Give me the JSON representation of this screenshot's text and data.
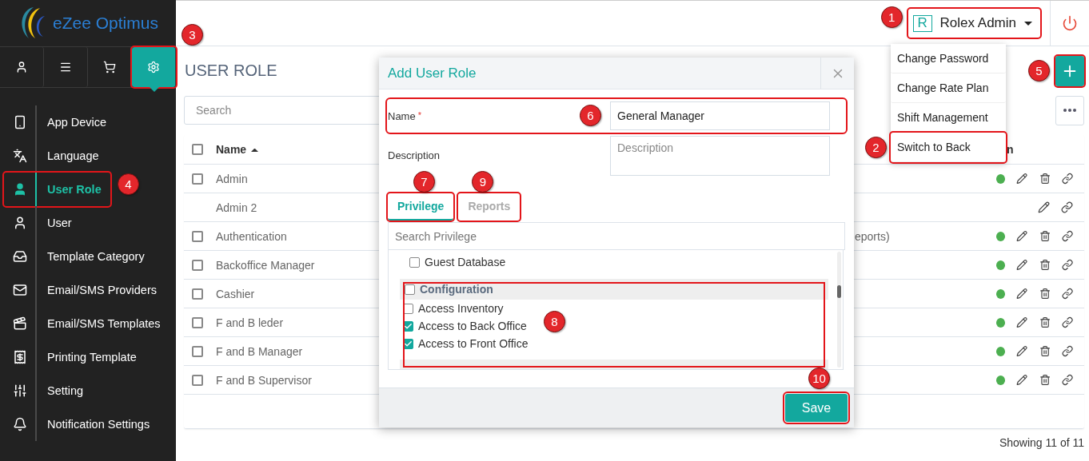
{
  "app": {
    "logo_text": "eZee Optimus"
  },
  "sidebar": {
    "tabs": [
      {
        "selected": false
      },
      {
        "selected": false
      },
      {
        "selected": false
      },
      {
        "selected": true,
        "callout": "3"
      }
    ],
    "items": [
      {
        "label": "App Device",
        "selected": false
      },
      {
        "label": "Language",
        "selected": false
      },
      {
        "label": "User Role",
        "selected": true,
        "callout": "4"
      },
      {
        "label": "User",
        "selected": false
      },
      {
        "label": "Template Category",
        "selected": false
      },
      {
        "label": "Email/SMS Providers",
        "selected": false
      },
      {
        "label": "Email/SMS Templates",
        "selected": false
      },
      {
        "label": "Printing Template",
        "selected": false
      },
      {
        "label": "Setting",
        "selected": false
      },
      {
        "label": "Notification Settings",
        "selected": false
      }
    ]
  },
  "header": {
    "user": {
      "initial": "R",
      "name": "Rolex Admin",
      "callout": "1"
    },
    "menu": [
      {
        "label": "Change Password"
      },
      {
        "label": "Change Rate Plan"
      },
      {
        "label": "Shift Management"
      },
      {
        "label": "Switch to Back",
        "callout": "2"
      }
    ]
  },
  "page": {
    "title": "USER ROLE",
    "search": {
      "placeholder": "Search"
    },
    "add_button": {
      "callout": "5"
    },
    "table": {
      "select_all": {
        "checked": false
      },
      "columns": [
        {
          "label": "Name",
          "sorted": true
        },
        {
          "label": "n",
          "sorted": false
        }
      ],
      "rows": [
        {
          "name": "Admin",
          "checkbox": true,
          "active": true,
          "deletable": true
        },
        {
          "name": "Admin 2",
          "checkbox": false,
          "active": false,
          "deletable": false
        },
        {
          "name": "Authentication",
          "checkbox": true,
          "active": true,
          "deletable": true,
          "note": "eports)"
        },
        {
          "name": "Backoffice Manager",
          "checkbox": true,
          "active": true,
          "deletable": true
        },
        {
          "name": "Cashier",
          "checkbox": true,
          "active": true,
          "deletable": true
        },
        {
          "name": "F and B leder",
          "checkbox": true,
          "active": true,
          "deletable": true
        },
        {
          "name": "F and B Manager",
          "checkbox": true,
          "active": true,
          "deletable": true
        },
        {
          "name": "F and B Supervisor",
          "checkbox": true,
          "active": true,
          "deletable": true
        }
      ]
    },
    "status": "Showing 11 of 11"
  },
  "modal": {
    "title": "Add User Role",
    "fields": [
      {
        "kind": "input",
        "label": "Name",
        "required_mark": "*",
        "value": "General Manager",
        "callout": "6"
      },
      {
        "kind": "textarea",
        "label": "Description",
        "placeholder": "Description"
      }
    ],
    "tabs": [
      {
        "label": "Privilege",
        "selected": true,
        "callout": "7"
      },
      {
        "label": "Reports",
        "selected": false,
        "callout": "9"
      }
    ],
    "search": {
      "placeholder": "Search Privilege"
    },
    "privileges": [
      {
        "kind": "item",
        "label": "Guest Database",
        "checked": false
      },
      {
        "kind": "group",
        "label": "Configuration",
        "checked": false,
        "callout": "8",
        "children": [
          {
            "kind": "item",
            "label": "Access Inventory",
            "checked": false
          },
          {
            "kind": "item",
            "label": "Access to Back Office",
            "checked": true
          },
          {
            "kind": "item",
            "label": "Access to Front Office",
            "checked": true
          }
        ]
      }
    ],
    "save": {
      "label": "Save",
      "callout": "10"
    }
  }
}
